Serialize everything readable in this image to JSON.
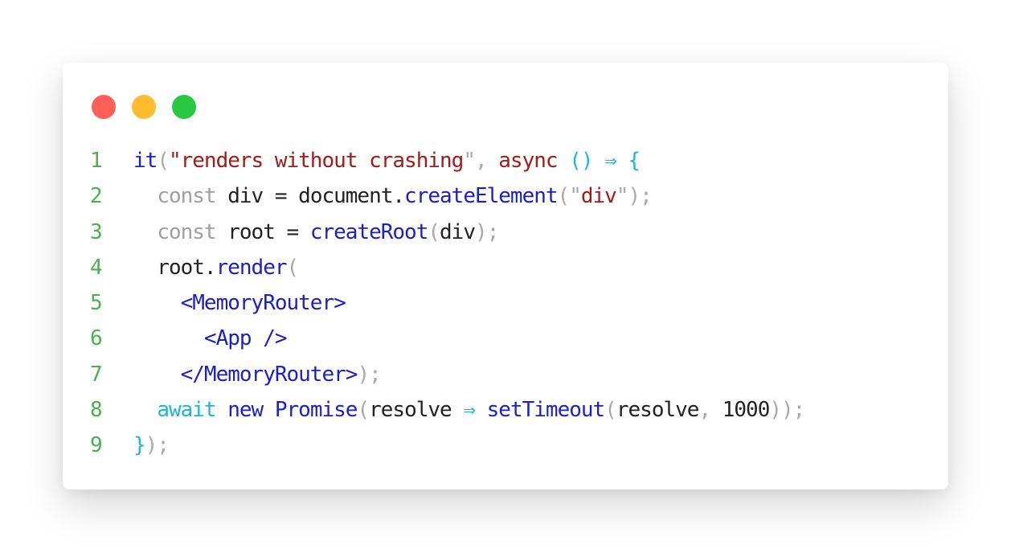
{
  "colors": {
    "dot_close": "#ff5f57",
    "dot_minimize": "#febc2e",
    "dot_zoom": "#28c840",
    "line_number": "#4caf50",
    "function": "#1a1fc7",
    "string": "#a31b1b",
    "punctuation": "#a9a9a9",
    "keyword": "#a0a0a0",
    "identifier": "#222222",
    "operator": "#1fb6d6"
  },
  "window_controls": [
    {
      "name": "close",
      "icon": "red-dot"
    },
    {
      "name": "minimize",
      "icon": "yellow-dot"
    },
    {
      "name": "zoom",
      "icon": "green-dot"
    }
  ],
  "code": {
    "lines": [
      {
        "number": "1",
        "tokens": [
          {
            "t": "it",
            "c": "tok-fn"
          },
          {
            "t": "(",
            "c": "tok-punc"
          },
          {
            "t": "\"renders without crashing",
            "c": "tok-str"
          },
          {
            "t": "\", ",
            "c": "tok-punc"
          },
          {
            "t": "async",
            "c": "tok-str"
          },
          {
            "t": " ",
            "c": "tok-id"
          },
          {
            "t": "() ⇒ {",
            "c": "tok-op"
          }
        ]
      },
      {
        "number": "2",
        "tokens": [
          {
            "t": "  ",
            "c": "tok-id"
          },
          {
            "t": "const",
            "c": "tok-kw"
          },
          {
            "t": " div = document.",
            "c": "tok-id"
          },
          {
            "t": "createElement",
            "c": "tok-fn"
          },
          {
            "t": "(\"",
            "c": "tok-punc"
          },
          {
            "t": "div",
            "c": "tok-str"
          },
          {
            "t": "\");",
            "c": "tok-punc"
          }
        ]
      },
      {
        "number": "3",
        "tokens": [
          {
            "t": "  ",
            "c": "tok-id"
          },
          {
            "t": "const",
            "c": "tok-kw"
          },
          {
            "t": " root = ",
            "c": "tok-id"
          },
          {
            "t": "createRoot",
            "c": "tok-fn"
          },
          {
            "t": "(",
            "c": "tok-punc"
          },
          {
            "t": "div",
            "c": "tok-id"
          },
          {
            "t": ");",
            "c": "tok-punc"
          }
        ]
      },
      {
        "number": "4",
        "tokens": [
          {
            "t": "  root.",
            "c": "tok-id"
          },
          {
            "t": "render",
            "c": "tok-fn"
          },
          {
            "t": "(",
            "c": "tok-punc"
          }
        ]
      },
      {
        "number": "5",
        "tokens": [
          {
            "t": "    ",
            "c": "tok-id"
          },
          {
            "t": "<MemoryRouter>",
            "c": "tok-tag"
          }
        ]
      },
      {
        "number": "6",
        "tokens": [
          {
            "t": "      ",
            "c": "tok-id"
          },
          {
            "t": "<App />",
            "c": "tok-tag"
          }
        ]
      },
      {
        "number": "7",
        "tokens": [
          {
            "t": "    ",
            "c": "tok-id"
          },
          {
            "t": "</MemoryRouter>",
            "c": "tok-tag"
          },
          {
            "t": ");",
            "c": "tok-punc"
          }
        ]
      },
      {
        "number": "8",
        "tokens": [
          {
            "t": "  ",
            "c": "tok-id"
          },
          {
            "t": "await",
            "c": "tok-op"
          },
          {
            "t": " ",
            "c": "tok-id"
          },
          {
            "t": "new",
            "c": "tok-fn"
          },
          {
            "t": " ",
            "c": "tok-id"
          },
          {
            "t": "Promise",
            "c": "tok-fn"
          },
          {
            "t": "(",
            "c": "tok-punc"
          },
          {
            "t": "resolve ",
            "c": "tok-id"
          },
          {
            "t": "⇒",
            "c": "tok-op"
          },
          {
            "t": " ",
            "c": "tok-id"
          },
          {
            "t": "setTimeout",
            "c": "tok-fn"
          },
          {
            "t": "(",
            "c": "tok-punc"
          },
          {
            "t": "resolve",
            "c": "tok-id"
          },
          {
            "t": ", ",
            "c": "tok-punc"
          },
          {
            "t": "1000",
            "c": "tok-num"
          },
          {
            "t": "));",
            "c": "tok-punc"
          }
        ]
      },
      {
        "number": "9",
        "tokens": [
          {
            "t": "}",
            "c": "tok-op"
          },
          {
            "t": ");",
            "c": "tok-punc"
          }
        ]
      }
    ]
  }
}
